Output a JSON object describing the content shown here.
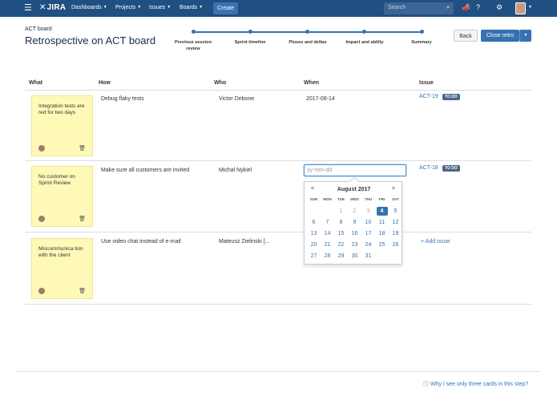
{
  "nav": {
    "logo": "JIRA",
    "items": [
      "Dashboards",
      "Projects",
      "Issues",
      "Boards"
    ],
    "create_label": "Create",
    "search_placeholder": "Search"
  },
  "header": {
    "breadcrumb": "ACT board",
    "title": "Retrospective on ACT board",
    "back_label": "Back",
    "close_label": "Close retro"
  },
  "steps": [
    {
      "label": "Previous session review"
    },
    {
      "label": "Sprint timeline"
    },
    {
      "label": "Pluses and deltas"
    },
    {
      "label": "Impact and ability"
    },
    {
      "label": "Summary"
    }
  ],
  "table": {
    "headers": [
      "What",
      "How",
      "Who",
      "When",
      "Issue"
    ],
    "rows": [
      {
        "what": "Integration tests are red for two days",
        "how": "Debug flaky tests",
        "who": "Victor Debone",
        "when": "2017-08-14",
        "issue": "ACT-19",
        "status": "TO DO"
      },
      {
        "what": "No customer on Sprint Review",
        "how": "Make sure all customers are invited",
        "who": "Michal Nykiel",
        "when_placeholder": "yy-mm-dd",
        "issue": "ACT-18",
        "status": "TO DO"
      },
      {
        "what": "Miscommunica tion with the client",
        "how": "Use video chat instead of e-mail",
        "who": "Mateusz Zielinski [...",
        "add_issue_label": "+ Add issue"
      }
    ]
  },
  "datepicker": {
    "month": "August 2017",
    "prev": "<",
    "next": ">",
    "dow": [
      "SUN",
      "MON",
      "TUE",
      "WED",
      "THU",
      "FRI",
      "SAT"
    ],
    "selected_day": 4
  },
  "footer": {
    "help": "Why I see only three cards in this step?"
  },
  "colors": {
    "nav": "#205081",
    "accent": "#3572b0",
    "card": "#fef9b7",
    "lozenge": "#4a6785"
  }
}
